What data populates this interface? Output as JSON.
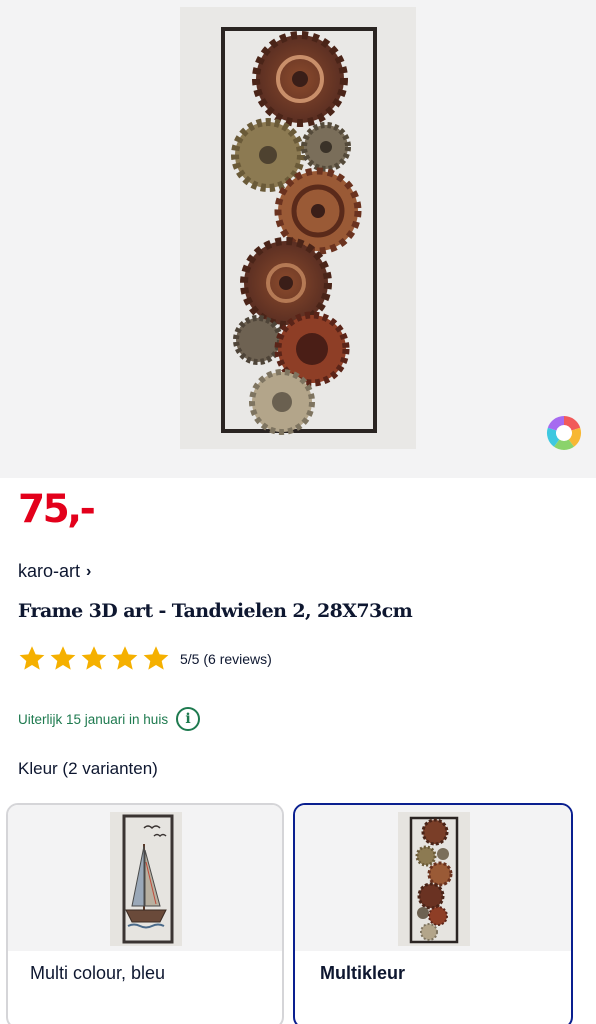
{
  "product": {
    "price": "75,-",
    "brand": "karo-art",
    "brand_chevron": "›",
    "title": "Frame 3D art - Tandwielen 2, 28X73cm",
    "rating": {
      "score": 5,
      "max": 5,
      "text": "5/5 (6 reviews)"
    },
    "delivery": "Uiterlijk 15 januari in huis",
    "info_icon_glyph": "i"
  },
  "variants": {
    "label": "Kleur (2 varianten)",
    "items": [
      {
        "label": "Multi colour, bleu",
        "selected": false,
        "image": "sailboat-wall-art"
      },
      {
        "label": "Multikleur",
        "selected": true,
        "image": "gears-wall-art"
      }
    ]
  },
  "icons": {
    "color_wheel": "color-wheel-icon",
    "star": "star-icon",
    "info": "info-icon",
    "chevron": "chevron-right-icon"
  },
  "colors": {
    "price": "#e3001b",
    "star": "#f5b000",
    "delivery": "#1e7a4f",
    "selected_border": "#0a1f8f",
    "text": "#0e1730"
  }
}
